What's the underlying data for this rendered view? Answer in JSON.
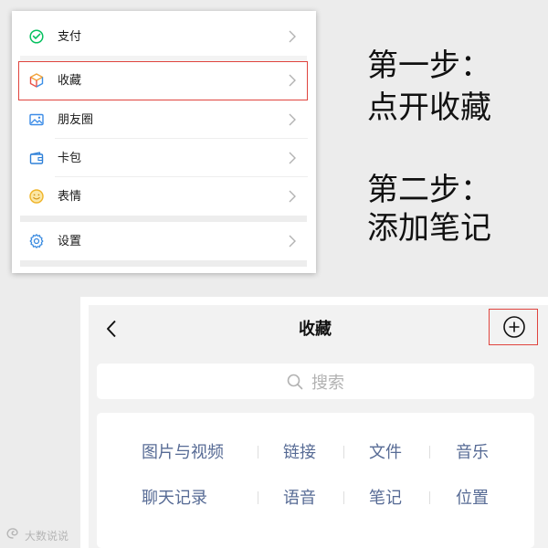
{
  "colors": {
    "page_background": "#ececec",
    "highlight_border": "#e0443e",
    "category_text": "#576b95",
    "placeholder_text": "#b2b2b2",
    "wechat_green": "#07c160"
  },
  "menu": {
    "items": [
      {
        "label": "支付",
        "icon": "wechat-pay-icon"
      },
      {
        "label": "收藏",
        "icon": "favorites-cube-icon",
        "highlighted": true
      },
      {
        "label": "朋友圈",
        "icon": "moments-photo-icon"
      },
      {
        "label": "卡包",
        "icon": "card-wallet-icon"
      },
      {
        "label": "表情",
        "icon": "sticker-smiley-icon"
      },
      {
        "label": "设置",
        "icon": "settings-gear-icon"
      }
    ]
  },
  "instructions": {
    "step1": {
      "title": "第一步：",
      "text": "点开收藏"
    },
    "step2": {
      "title": "第二步：",
      "text": "添加笔记"
    }
  },
  "favorites_screen": {
    "back_icon": "back-chevron-icon",
    "title": "收藏",
    "add_icon": "plus-circle-icon",
    "add_highlighted": true,
    "search": {
      "icon": "search-icon",
      "placeholder": "搜索"
    },
    "categories": [
      [
        "图片与视频",
        "链接",
        "文件",
        "音乐"
      ],
      [
        "聊天记录",
        "语音",
        "笔记",
        "位置"
      ]
    ]
  },
  "watermark": {
    "text": "大数说说"
  }
}
